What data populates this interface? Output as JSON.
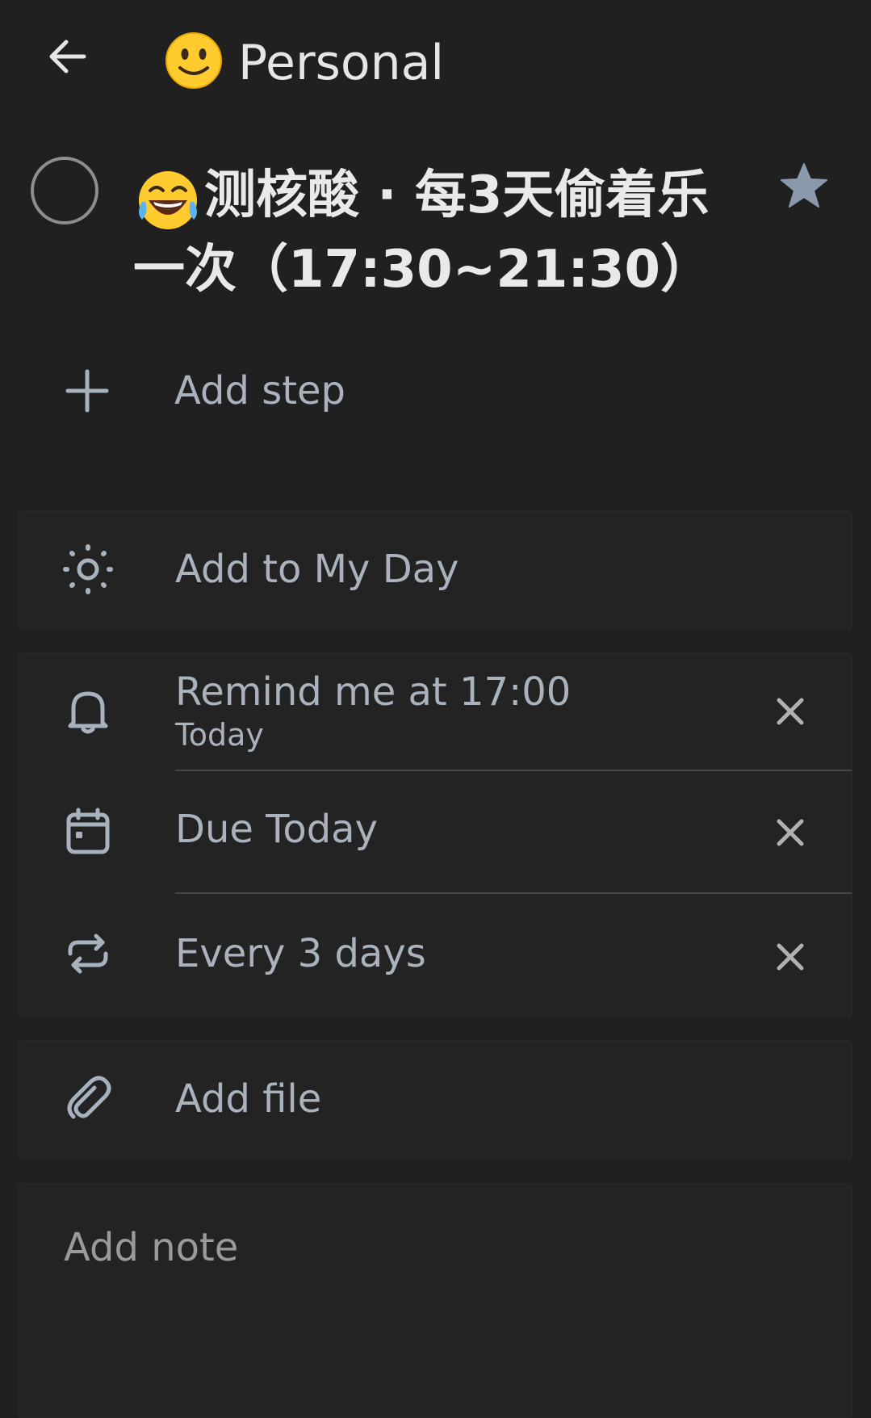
{
  "header": {
    "list_emoji": "slightly-smiling-face",
    "list_title": "Personal"
  },
  "task": {
    "emoji": "face-with-tears-of-joy",
    "title": "测核酸 · 每3天偷着乐一次（17:30~21:30）",
    "completed": false,
    "important": true
  },
  "add_step": {
    "label": "Add step"
  },
  "my_day": {
    "label": "Add to My Day"
  },
  "reminder": {
    "label": "Remind me at 17:00",
    "sublabel": "Today"
  },
  "due": {
    "label": "Due Today"
  },
  "repeat": {
    "label": "Every 3 days"
  },
  "file": {
    "label": "Add file"
  },
  "note": {
    "placeholder": "Add note"
  },
  "colors": {
    "background": "#202020",
    "card": "#232323",
    "accent_text": "#aab2bd",
    "icon": "#a7b2be",
    "star": "#8a9aac"
  }
}
